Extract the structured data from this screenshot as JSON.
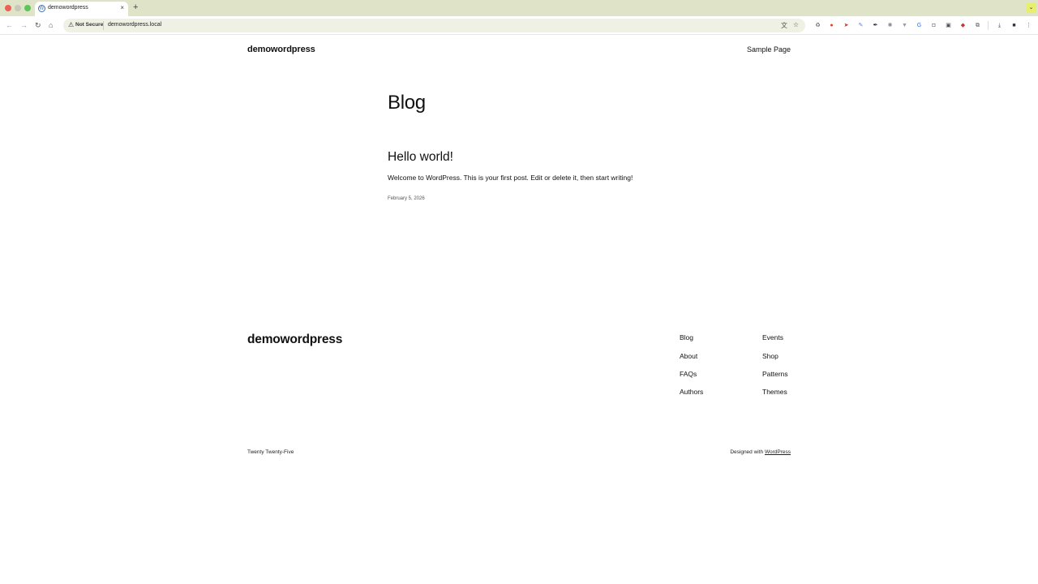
{
  "browser": {
    "tab": {
      "title": "demowordpress",
      "favicon_letter": "W",
      "close_glyph": "×"
    },
    "new_tab_glyph": "+",
    "profile_menu_glyph": "⌄",
    "toolbar": {
      "back_glyph": "←",
      "forward_glyph": "→",
      "reload_glyph": "↻",
      "home_glyph": "⌂"
    },
    "address_bar": {
      "security_warning_glyph": "⚠",
      "security_label": "Not Secure",
      "url": "demowordpress.local",
      "translate_glyph": "文",
      "bookmark_glyph": "☆"
    },
    "extension_icons": [
      {
        "name": "recycle-icon",
        "glyph": "♻",
        "color": "#666666"
      },
      {
        "name": "shield-ext-icon",
        "glyph": "●",
        "color": "#d9412b"
      },
      {
        "name": "rocket-icon",
        "glyph": "➤",
        "color": "#c0392b"
      },
      {
        "name": "pen-icon",
        "glyph": "✎",
        "color": "#6a7fd6"
      },
      {
        "name": "eyedropper-icon",
        "glyph": "✒",
        "color": "#222222"
      },
      {
        "name": "openai-icon",
        "glyph": "✺",
        "color": "#888888"
      },
      {
        "name": "filter-icon",
        "glyph": "▼",
        "color": "#999999"
      },
      {
        "name": "translate-ext-icon",
        "glyph": "G",
        "color": "#3b73d9"
      },
      {
        "name": "camera-icon",
        "glyph": "◘",
        "color": "#777777"
      },
      {
        "name": "screenshot-icon",
        "glyph": "▣",
        "color": "#555555"
      },
      {
        "name": "ublock-icon",
        "glyph": "◆",
        "color": "#c0392b"
      },
      {
        "name": "puzzle-icon",
        "glyph": "⧉",
        "color": "#555555"
      },
      {
        "name": "download-icon",
        "glyph": "⤓",
        "color": "#444444"
      },
      {
        "name": "profile-icon",
        "glyph": "■",
        "color": "#333333"
      },
      {
        "name": "more-menu-icon",
        "glyph": "⋮",
        "color": "#444444"
      }
    ]
  },
  "site": {
    "title": "demowordpress",
    "header_nav": {
      "sample_page": "Sample Page"
    }
  },
  "main": {
    "heading": "Blog",
    "posts": [
      {
        "title": "Hello world!",
        "excerpt": "Welcome to WordPress. This is your first post. Edit or delete it, then start writing!",
        "date": "February 5, 2026"
      }
    ]
  },
  "footer": {
    "title": "demowordpress",
    "nav_col1": [
      "Blog",
      "About",
      "FAQs",
      "Authors"
    ],
    "nav_col2": [
      "Events",
      "Shop",
      "Patterns",
      "Themes"
    ],
    "theme_name": "Twenty Twenty-Five",
    "credit_prefix": "Designed with",
    "credit_link": "WordPress"
  }
}
